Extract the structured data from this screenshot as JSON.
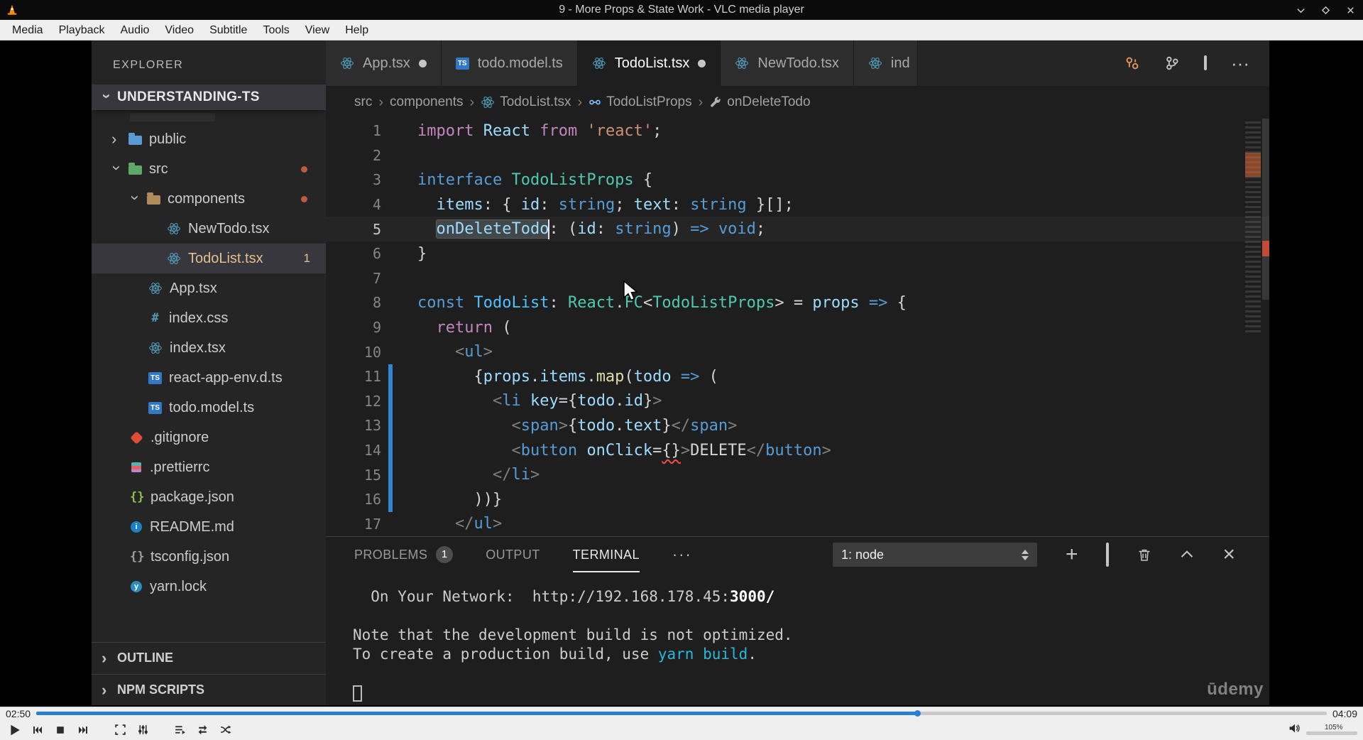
{
  "vlc": {
    "window_title": "9 - More Props & State Work - VLC media player",
    "menu_items": [
      "Media",
      "Playback",
      "Audio",
      "Video",
      "Subtitle",
      "Tools",
      "View",
      "Help"
    ],
    "time_elapsed": "02:50",
    "time_total": "04:09",
    "progress_percent": 68.3,
    "volume_label": "105%",
    "accent_color": "#2a7fd4"
  },
  "vscode": {
    "explorer": {
      "title": "EXPLORER",
      "root_label": "UNDERSTANDING-TS",
      "items": [
        {
          "label": "public",
          "level": 1,
          "type": "folder",
          "icon": "folder",
          "expanded": false
        },
        {
          "label": "src",
          "level": 1,
          "type": "folder",
          "icon": "folder-src",
          "expanded": true,
          "dot": true
        },
        {
          "label": "components",
          "level": 2,
          "type": "folder",
          "icon": "folder-components",
          "expanded": true,
          "dot": true
        },
        {
          "label": "NewTodo.tsx",
          "level": 3,
          "icon": "react"
        },
        {
          "label": "TodoList.tsx",
          "level": 3,
          "icon": "react",
          "selected": true,
          "badge": "1",
          "modified": true
        },
        {
          "label": "App.tsx",
          "level": 2,
          "icon": "react"
        },
        {
          "label": "index.css",
          "level": 2,
          "icon": "css"
        },
        {
          "label": "index.tsx",
          "level": 2,
          "icon": "react"
        },
        {
          "label": "react-app-env.d.ts",
          "level": 2,
          "icon": "ts"
        },
        {
          "label": "todo.model.ts",
          "level": 2,
          "icon": "ts"
        },
        {
          "label": ".gitignore",
          "level": 1,
          "icon": "git"
        },
        {
          "label": ".prettierrc",
          "level": 1,
          "icon": "prettier"
        },
        {
          "label": "package.json",
          "level": 1,
          "icon": "npm"
        },
        {
          "label": "README.md",
          "level": 1,
          "icon": "info"
        },
        {
          "label": "tsconfig.json",
          "level": 1,
          "icon": "json"
        },
        {
          "label": "yarn.lock",
          "level": 1,
          "icon": "yarn"
        }
      ],
      "bottom_sections": [
        "OUTLINE",
        "NPM SCRIPTS"
      ]
    },
    "tabs": [
      {
        "label": "App.tsx",
        "icon": "react",
        "modified": true
      },
      {
        "label": "todo.model.ts",
        "icon": "ts"
      },
      {
        "label": "TodoList.tsx",
        "icon": "react",
        "modified": true,
        "active": true
      },
      {
        "label": "NewTodo.tsx",
        "icon": "react"
      },
      {
        "label": "ind",
        "icon": "react",
        "clipped": true
      }
    ],
    "breadcrumb": [
      {
        "label": "src"
      },
      {
        "label": "components"
      },
      {
        "label": "TodoList.tsx",
        "icon": "react"
      },
      {
        "label": "TodoListProps",
        "icon": "interface"
      },
      {
        "label": "onDeleteTodo",
        "icon": "wrench"
      }
    ],
    "code": {
      "lines": [
        {
          "n": 1,
          "segs": [
            {
              "t": "import",
              "c": "ctrl"
            },
            {
              "t": " "
            },
            {
              "t": "React",
              "c": "var"
            },
            {
              "t": " "
            },
            {
              "t": "from",
              "c": "ctrl"
            },
            {
              "t": " "
            },
            {
              "t": "'react'",
              "c": "str"
            },
            {
              "t": ";",
              "c": "fg"
            }
          ]
        },
        {
          "n": 2,
          "segs": []
        },
        {
          "n": 3,
          "segs": [
            {
              "t": "interface",
              "c": "kw"
            },
            {
              "t": " "
            },
            {
              "t": "TodoListProps",
              "c": "type"
            },
            {
              "t": " {",
              "c": "fg"
            }
          ]
        },
        {
          "n": 4,
          "segs": [
            {
              "t": "  "
            },
            {
              "t": "items",
              "c": "var"
            },
            {
              "t": ": { ",
              "c": "fg"
            },
            {
              "t": "id",
              "c": "var"
            },
            {
              "t": ": ",
              "c": "fg"
            },
            {
              "t": "string",
              "c": "kw"
            },
            {
              "t": "; ",
              "c": "fg"
            },
            {
              "t": "text",
              "c": "var"
            },
            {
              "t": ": ",
              "c": "fg"
            },
            {
              "t": "string",
              "c": "kw"
            },
            {
              "t": " }[];",
              "c": "fg"
            }
          ]
        },
        {
          "n": 5,
          "current": true,
          "segs": [
            {
              "t": "  "
            },
            {
              "t": "onDeleteTodo",
              "c": "var",
              "hl": true,
              "cur": true
            },
            {
              "t": ": (",
              "c": "fg"
            },
            {
              "t": "id",
              "c": "var"
            },
            {
              "t": ": ",
              "c": "fg"
            },
            {
              "t": "string",
              "c": "kw"
            },
            {
              "t": ") ",
              "c": "fg"
            },
            {
              "t": "=>",
              "c": "kw"
            },
            {
              "t": " ",
              "c": "fg"
            },
            {
              "t": "void",
              "c": "kw"
            },
            {
              "t": ";",
              "c": "fg"
            }
          ]
        },
        {
          "n": 6,
          "segs": [
            {
              "t": "}",
              "c": "fg"
            }
          ]
        },
        {
          "n": 7,
          "segs": []
        },
        {
          "n": 8,
          "segs": [
            {
              "t": "const",
              "c": "kw"
            },
            {
              "t": " "
            },
            {
              "t": "TodoList",
              "c": "cvar"
            },
            {
              "t": ": ",
              "c": "fg"
            },
            {
              "t": "React",
              "c": "type"
            },
            {
              "t": ".",
              "c": "fg"
            },
            {
              "t": "FC",
              "c": "type"
            },
            {
              "t": "<",
              "c": "fg"
            },
            {
              "t": "TodoListProps",
              "c": "type"
            },
            {
              "t": "> = ",
              "c": "fg"
            },
            {
              "t": "props",
              "c": "var"
            },
            {
              "t": " ",
              "c": "fg"
            },
            {
              "t": "=>",
              "c": "kw"
            },
            {
              "t": " {",
              "c": "fg"
            }
          ]
        },
        {
          "n": 9,
          "segs": [
            {
              "t": "  "
            },
            {
              "t": "return",
              "c": "ctrl"
            },
            {
              "t": " (",
              "c": "fg"
            }
          ]
        },
        {
          "n": 10,
          "segs": [
            {
              "t": "    "
            },
            {
              "t": "<",
              "c": "pun"
            },
            {
              "t": "ul",
              "c": "kw"
            },
            {
              "t": ">",
              "c": "pun"
            }
          ]
        },
        {
          "n": 11,
          "changed": true,
          "segs": [
            {
              "t": "      {",
              "c": "fg"
            },
            {
              "t": "props",
              "c": "var"
            },
            {
              "t": ".",
              "c": "fg"
            },
            {
              "t": "items",
              "c": "var"
            },
            {
              "t": ".",
              "c": "fg"
            },
            {
              "t": "map",
              "c": "func"
            },
            {
              "t": "(",
              "c": "fg"
            },
            {
              "t": "todo",
              "c": "var"
            },
            {
              "t": " ",
              "c": "fg"
            },
            {
              "t": "=>",
              "c": "kw"
            },
            {
              "t": " (",
              "c": "fg"
            }
          ]
        },
        {
          "n": 12,
          "changed": true,
          "segs": [
            {
              "t": "        "
            },
            {
              "t": "<",
              "c": "pun"
            },
            {
              "t": "li",
              "c": "kw"
            },
            {
              "t": " ",
              "c": "fg"
            },
            {
              "t": "key",
              "c": "var"
            },
            {
              "t": "={",
              "c": "fg"
            },
            {
              "t": "todo",
              "c": "var"
            },
            {
              "t": ".",
              "c": "fg"
            },
            {
              "t": "id",
              "c": "var"
            },
            {
              "t": "}",
              "c": "fg"
            },
            {
              "t": ">",
              "c": "pun"
            }
          ]
        },
        {
          "n": 13,
          "changed": true,
          "segs": [
            {
              "t": "          "
            },
            {
              "t": "<",
              "c": "pun"
            },
            {
              "t": "span",
              "c": "kw"
            },
            {
              "t": ">",
              "c": "pun"
            },
            {
              "t": "{",
              "c": "fg"
            },
            {
              "t": "todo",
              "c": "var"
            },
            {
              "t": ".",
              "c": "fg"
            },
            {
              "t": "text",
              "c": "var"
            },
            {
              "t": "}",
              "c": "fg"
            },
            {
              "t": "</",
              "c": "pun"
            },
            {
              "t": "span",
              "c": "kw"
            },
            {
              "t": ">",
              "c": "pun"
            }
          ]
        },
        {
          "n": 14,
          "changed": true,
          "segs": [
            {
              "t": "          "
            },
            {
              "t": "<",
              "c": "pun"
            },
            {
              "t": "button",
              "c": "kw"
            },
            {
              "t": " ",
              "c": "fg"
            },
            {
              "t": "onClick",
              "c": "var"
            },
            {
              "t": "=",
              "c": "fg"
            },
            {
              "t": "{}",
              "c": "fg",
              "err": true
            },
            {
              "t": ">",
              "c": "pun"
            },
            {
              "t": "DELETE",
              "c": "fg"
            },
            {
              "t": "</",
              "c": "pun"
            },
            {
              "t": "button",
              "c": "kw"
            },
            {
              "t": ">",
              "c": "pun"
            }
          ]
        },
        {
          "n": 15,
          "changed": true,
          "segs": [
            {
              "t": "        "
            },
            {
              "t": "</",
              "c": "pun"
            },
            {
              "t": "li",
              "c": "kw"
            },
            {
              "t": ">",
              "c": "pun"
            }
          ]
        },
        {
          "n": 16,
          "changed": true,
          "segs": [
            {
              "t": "      ))}",
              "c": "fg"
            }
          ]
        },
        {
          "n": 17,
          "segs": [
            {
              "t": "    "
            },
            {
              "t": "</",
              "c": "pun"
            },
            {
              "t": "ul",
              "c": "kw"
            },
            {
              "t": ">",
              "c": "pun"
            }
          ]
        }
      ]
    },
    "panel": {
      "tabs": [
        {
          "label": "PROBLEMS",
          "badge": "1"
        },
        {
          "label": "OUTPUT"
        },
        {
          "label": "TERMINAL",
          "active": true
        }
      ],
      "terminal_dropdown": "1: node",
      "terminal_lines": [
        {
          "segs": [
            {
              "t": "  On Your Network:  "
            },
            {
              "t": "http://192.168.178.45:"
            },
            {
              "t": "3000/",
              "c": "bold"
            }
          ]
        },
        {
          "segs": []
        },
        {
          "segs": [
            {
              "t": "Note that the development build is not optimized."
            }
          ]
        },
        {
          "segs": [
            {
              "t": "To create a production build, use "
            },
            {
              "t": "yarn build",
              "c": "cyan"
            },
            {
              "t": "."
            }
          ]
        },
        {
          "segs": []
        },
        {
          "cursor": true
        }
      ]
    },
    "watermark": "ūdemy"
  }
}
